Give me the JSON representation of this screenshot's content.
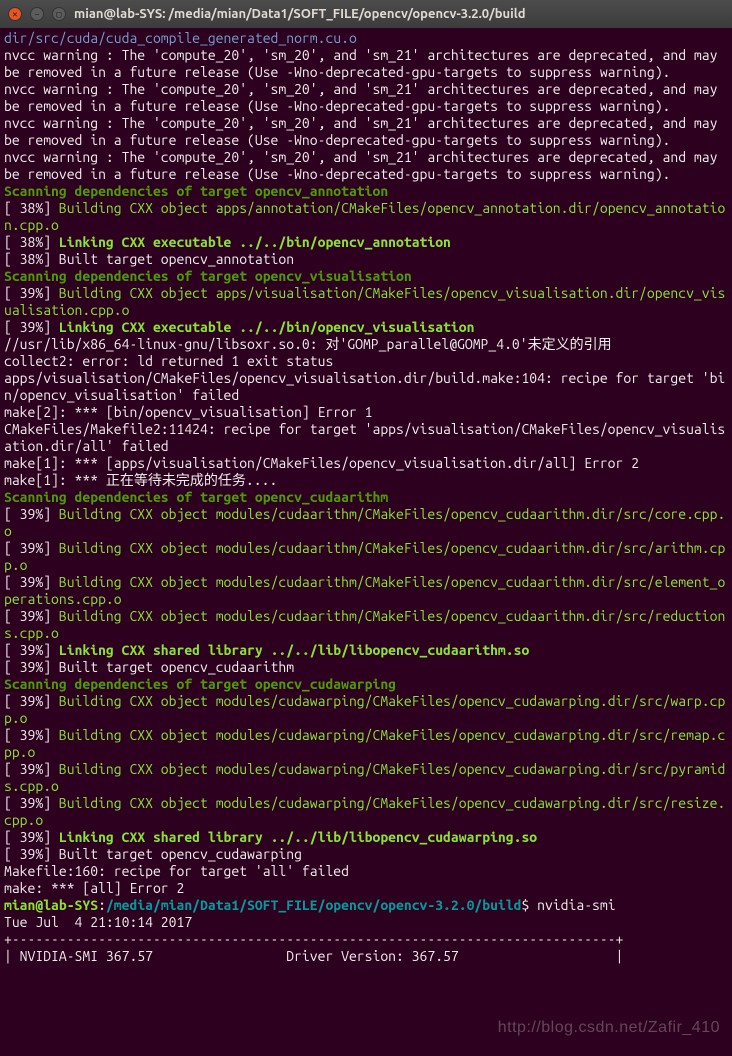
{
  "window": {
    "title": "mian@lab-SYS: /media/mian/Data1/SOFT_FILE/opencv/opencv-3.2.0/build"
  },
  "lines": [
    {
      "cls": "c-blue",
      "text": "dir/src/cuda/cuda_compile_generated_norm.cu.o"
    },
    {
      "cls": "c-white",
      "text": "nvcc warning : The 'compute_20', 'sm_20', and 'sm_21' architectures are deprecated, and may be removed in a future release (Use -Wno-deprecated-gpu-targets to suppress warning)."
    },
    {
      "cls": "c-white",
      "text": "nvcc warning : The 'compute_20', 'sm_20', and 'sm_21' architectures are deprecated, and may be removed in a future release (Use -Wno-deprecated-gpu-targets to suppress warning)."
    },
    {
      "cls": "c-white",
      "text": "nvcc warning : The 'compute_20', 'sm_20', and 'sm_21' architectures are deprecated, and may be removed in a future release (Use -Wno-deprecated-gpu-targets to suppress warning)."
    },
    {
      "cls": "c-white",
      "text": "nvcc warning : The 'compute_20', 'sm_20', and 'sm_21' architectures are deprecated, and may be removed in a future release (Use -Wno-deprecated-gpu-targets to suppress warning)."
    },
    {
      "cls": "c-greenB",
      "text": "Scanning dependencies of target opencv_annotation"
    },
    {
      "cls": "mix",
      "parts": [
        {
          "cls": "c-white",
          "text": "[ 38%] "
        },
        {
          "cls": "c-green",
          "text": "Building CXX object apps/annotation/CMakeFiles/opencv_annotation.dir/opencv_annotation.cpp.o"
        }
      ]
    },
    {
      "cls": "mix",
      "parts": [
        {
          "cls": "c-white",
          "text": "[ 38%] "
        },
        {
          "cls": "c-lime",
          "text": "Linking CXX executable ../../bin/opencv_annotation"
        }
      ]
    },
    {
      "cls": "c-white",
      "text": "[ 38%] Built target opencv_annotation"
    },
    {
      "cls": "c-greenB",
      "text": "Scanning dependencies of target opencv_visualisation"
    },
    {
      "cls": "mix",
      "parts": [
        {
          "cls": "c-white",
          "text": "[ 39%] "
        },
        {
          "cls": "c-green",
          "text": "Building CXX object apps/visualisation/CMakeFiles/opencv_visualisation.dir/opencv_visualisation.cpp.o"
        }
      ]
    },
    {
      "cls": "mix",
      "parts": [
        {
          "cls": "c-white",
          "text": "[ 39%] "
        },
        {
          "cls": "c-lime",
          "text": "Linking CXX executable ../../bin/opencv_visualisation"
        }
      ]
    },
    {
      "cls": "c-white",
      "text": "//usr/lib/x86_64-linux-gnu/libsoxr.so.0: 对'GOMP_parallel@GOMP_4.0'未定义的引用"
    },
    {
      "cls": "c-white",
      "text": "collect2: error: ld returned 1 exit status"
    },
    {
      "cls": "c-white",
      "text": "apps/visualisation/CMakeFiles/opencv_visualisation.dir/build.make:104: recipe for target 'bin/opencv_visualisation' failed"
    },
    {
      "cls": "c-white",
      "text": "make[2]: *** [bin/opencv_visualisation] Error 1"
    },
    {
      "cls": "c-white",
      "text": "CMakeFiles/Makefile2:11424: recipe for target 'apps/visualisation/CMakeFiles/opencv_visualisation.dir/all' failed"
    },
    {
      "cls": "c-white",
      "text": "make[1]: *** [apps/visualisation/CMakeFiles/opencv_visualisation.dir/all] Error 2"
    },
    {
      "cls": "c-white",
      "text": "make[1]: *** 正在等待未完成的任务...."
    },
    {
      "cls": "c-greenB",
      "text": "Scanning dependencies of target opencv_cudaarithm"
    },
    {
      "cls": "mix",
      "parts": [
        {
          "cls": "c-white",
          "text": "[ 39%] "
        },
        {
          "cls": "c-green",
          "text": "Building CXX object modules/cudaarithm/CMakeFiles/opencv_cudaarithm.dir/src/core.cpp.o"
        }
      ]
    },
    {
      "cls": "mix",
      "parts": [
        {
          "cls": "c-white",
          "text": "[ 39%] "
        },
        {
          "cls": "c-green",
          "text": "Building CXX object modules/cudaarithm/CMakeFiles/opencv_cudaarithm.dir/src/arithm.cpp.o"
        }
      ]
    },
    {
      "cls": "mix",
      "parts": [
        {
          "cls": "c-white",
          "text": "[ 39%] "
        },
        {
          "cls": "c-green",
          "text": "Building CXX object modules/cudaarithm/CMakeFiles/opencv_cudaarithm.dir/src/element_operations.cpp.o"
        }
      ]
    },
    {
      "cls": "mix",
      "parts": [
        {
          "cls": "c-white",
          "text": "[ 39%] "
        },
        {
          "cls": "c-green",
          "text": "Building CXX object modules/cudaarithm/CMakeFiles/opencv_cudaarithm.dir/src/reductions.cpp.o"
        }
      ]
    },
    {
      "cls": "mix",
      "parts": [
        {
          "cls": "c-white",
          "text": "[ 39%] "
        },
        {
          "cls": "c-lime",
          "text": "Linking CXX shared library ../../lib/libopencv_cudaarithm.so"
        }
      ]
    },
    {
      "cls": "c-white",
      "text": "[ 39%] Built target opencv_cudaarithm"
    },
    {
      "cls": "c-greenB",
      "text": "Scanning dependencies of target opencv_cudawarping"
    },
    {
      "cls": "mix",
      "parts": [
        {
          "cls": "c-white",
          "text": "[ 39%] "
        },
        {
          "cls": "c-green",
          "text": "Building CXX object modules/cudawarping/CMakeFiles/opencv_cudawarping.dir/src/warp.cpp.o"
        }
      ]
    },
    {
      "cls": "mix",
      "parts": [
        {
          "cls": "c-white",
          "text": "[ 39%] "
        },
        {
          "cls": "c-green",
          "text": "Building CXX object modules/cudawarping/CMakeFiles/opencv_cudawarping.dir/src/remap.cpp.o"
        }
      ]
    },
    {
      "cls": "mix",
      "parts": [
        {
          "cls": "c-white",
          "text": "[ 39%] "
        },
        {
          "cls": "c-green",
          "text": "Building CXX object modules/cudawarping/CMakeFiles/opencv_cudawarping.dir/src/pyramids.cpp.o"
        }
      ]
    },
    {
      "cls": "mix",
      "parts": [
        {
          "cls": "c-white",
          "text": "[ 39%] "
        },
        {
          "cls": "c-green",
          "text": "Building CXX object modules/cudawarping/CMakeFiles/opencv_cudawarping.dir/src/resize.cpp.o"
        }
      ]
    },
    {
      "cls": "mix",
      "parts": [
        {
          "cls": "c-white",
          "text": "[ 39%] "
        },
        {
          "cls": "c-lime",
          "text": "Linking CXX shared library ../../lib/libopencv_cudawarping.so"
        }
      ]
    },
    {
      "cls": "c-white",
      "text": "[ 39%] Built target opencv_cudawarping"
    },
    {
      "cls": "c-white",
      "text": "Makefile:160: recipe for target 'all' failed"
    },
    {
      "cls": "c-white",
      "text": "make: *** [all] Error 2"
    },
    {
      "cls": "prompt",
      "user": "mian@lab-SYS",
      "colon": ":",
      "path": "/media/mian/Data1/SOFT_FILE/opencv/opencv-3.2.0/build",
      "dollar": "$ ",
      "cmd": "nvidia-smi"
    },
    {
      "cls": "c-white",
      "text": "Tue Jul  4 21:10:14 2017"
    },
    {
      "cls": "c-white",
      "text": "+-----------------------------------------------------------------------------+"
    },
    {
      "cls": "c-white",
      "text": "| NVIDIA-SMI 367.57                 Driver Version: 367.57                    |"
    }
  ],
  "watermark": "http://blog.csdn.net/Zafir_410"
}
